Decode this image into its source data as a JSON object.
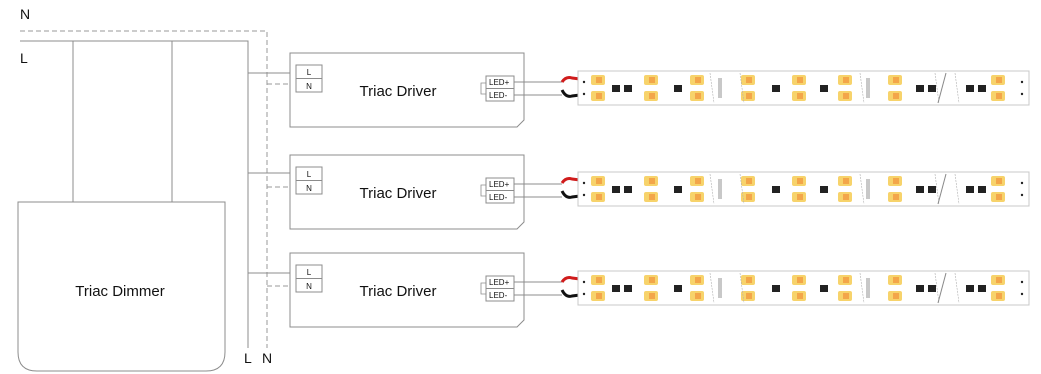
{
  "wires": {
    "neutral_top": "N",
    "live_top": "L",
    "live_bottom": "L",
    "neutral_bottom": "N"
  },
  "dimmer": {
    "label": "Triac Dimmer"
  },
  "drivers": [
    {
      "title": "Triac Driver",
      "in_l": "L",
      "in_n": "N",
      "out_pos": "LED+",
      "out_neg": "LED-"
    },
    {
      "title": "Triac Driver",
      "in_l": "L",
      "in_n": "N",
      "out_pos": "LED+",
      "out_neg": "LED-"
    },
    {
      "title": "Triac Driver",
      "in_l": "L",
      "in_n": "N",
      "out_pos": "LED+",
      "out_neg": "LED-"
    }
  ],
  "colors": {
    "line": "#8c8c8c",
    "wire_red": "#d01c1c",
    "wire_black": "#111111",
    "led_yellow": "#f7d36b",
    "led_warm": "#f3a64a",
    "chip": "#222222",
    "strip_border": "#c8c8c8"
  },
  "icons": {
    "strip": "led-strip-icon",
    "wire_pair": "wire-pair-icon"
  }
}
